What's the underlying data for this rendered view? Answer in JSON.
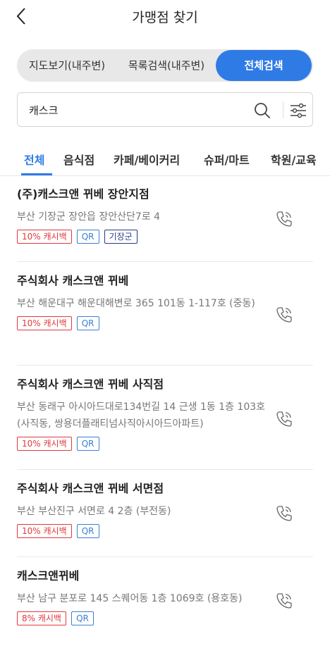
{
  "header": {
    "title": "가맹점 찾기"
  },
  "segments": [
    "지도보기(내주변)",
    "목록검색(내주변)",
    "전체검색"
  ],
  "search": {
    "value": "캐스크"
  },
  "tabs": [
    "전체",
    "음식점",
    "카페/베이커리",
    "슈퍼/마트",
    "학원/교육"
  ],
  "merchants": [
    {
      "name": "(주)캐스크앤 뀌베 장안지점",
      "address": "부산 기장군 장안읍 장안산단7로 4",
      "cashback": "10% 캐시백",
      "qr": "QR",
      "region": "기장군"
    },
    {
      "name": "주식회사 캐스크앤 뀌베",
      "address": "부산 해운대구 해운대해변로 365 101동 1-117호 (중동)",
      "cashback": "10% 캐시백",
      "qr": "QR"
    },
    {
      "name": "주식회사 캐스크앤 뀌베 사직점",
      "address": "부산 동래구 아시아드대로134번길 14 근생 1동 1층 103호 (사직동, 쌍용더플래티넘사직아시아드아파트)",
      "cashback": "10% 캐시백",
      "qr": "QR"
    },
    {
      "name": "주식회사 캐스크앤 뀌베 서면점",
      "address": "부산 부산진구 서면로 4 2층 (부전동)",
      "cashback": "10% 캐시백",
      "qr": "QR"
    },
    {
      "name": "캐스크앤뀌베",
      "address": "부산 남구 분포로 145 스퀘어동 1층 1069호 (용호동)",
      "cashback": "8% 캐시백",
      "qr": "QR"
    }
  ],
  "colors": {
    "accent": "#2f7be6",
    "cashback": "#e0393e",
    "qr": "#3b7fd4",
    "region": "#2a3a85"
  },
  "icons": {
    "back": "chevron-left-icon",
    "search": "search-icon",
    "filter": "filter-sliders-icon",
    "phone": "phone-icon"
  }
}
